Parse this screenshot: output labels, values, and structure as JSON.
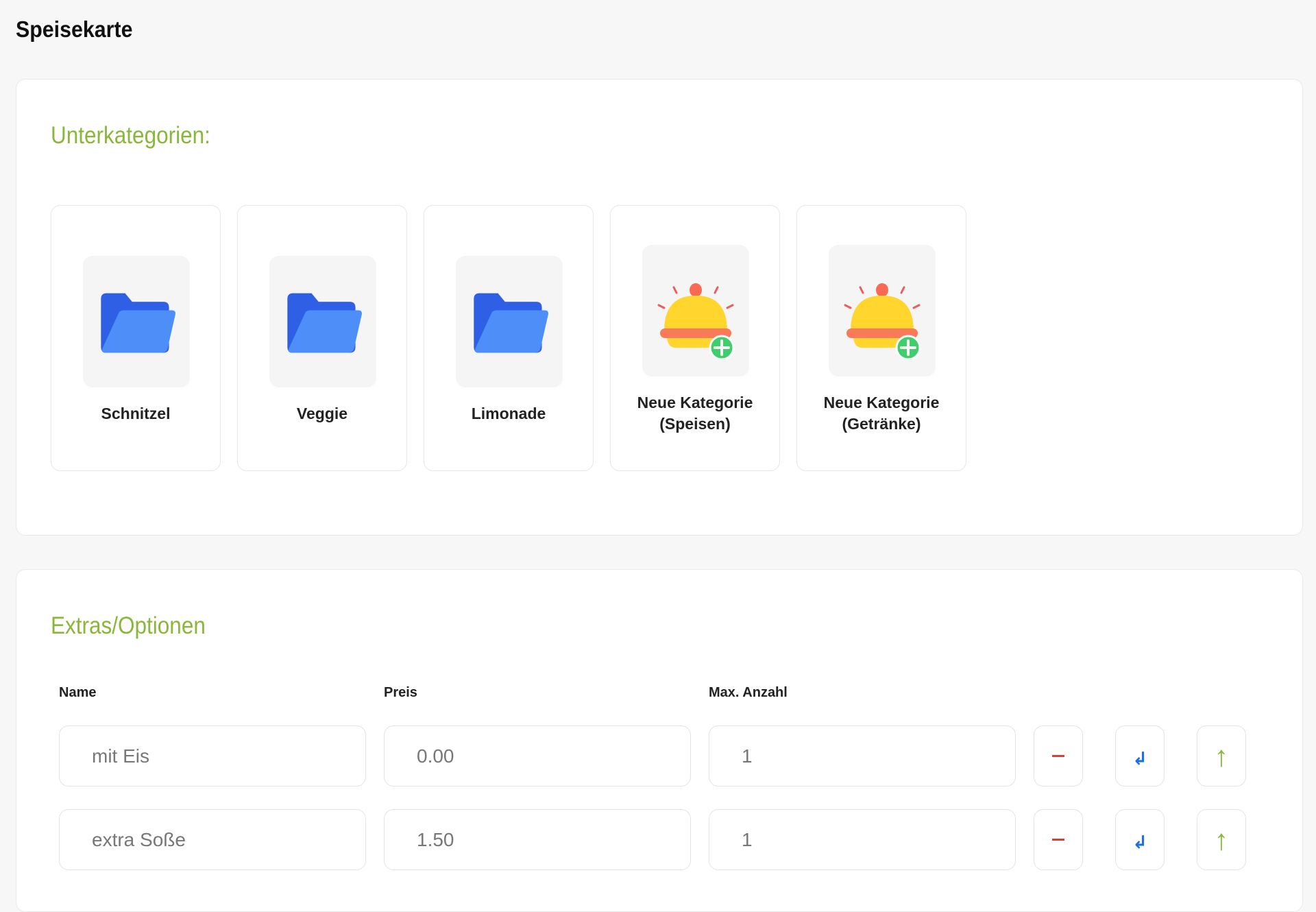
{
  "page": {
    "title": "Speisekarte"
  },
  "subcategories": {
    "heading": "Unterkategorien:",
    "items": [
      {
        "label": "Schnitzel",
        "icon": "folder-icon"
      },
      {
        "label": "Veggie",
        "icon": "folder-icon"
      },
      {
        "label": "Limonade",
        "icon": "folder-icon"
      },
      {
        "label_line1": "Neue Kategorie",
        "label_line2": "(Speisen)",
        "icon": "cloche-add-icon"
      },
      {
        "label_line1": "Neue Kategorie",
        "label_line2": "(Getränke)",
        "icon": "cloche-add-icon"
      }
    ]
  },
  "extras": {
    "heading": "Extras/Optionen",
    "columns": {
      "name": "Name",
      "price": "Preis",
      "max": "Max. Anzahl"
    },
    "rows": [
      {
        "name": "mit Eis",
        "price": "0.00",
        "max": "1"
      },
      {
        "name": "extra Soße",
        "price": "1.50",
        "max": "1"
      }
    ],
    "buttons": {
      "remove": "−",
      "enter": "↲",
      "up": "↑"
    }
  },
  "colors": {
    "accent_green": "#8ab73a",
    "folder_blue": "#3d74f0",
    "remove_red": "#e53935",
    "enter_blue": "#1e6fe0"
  }
}
